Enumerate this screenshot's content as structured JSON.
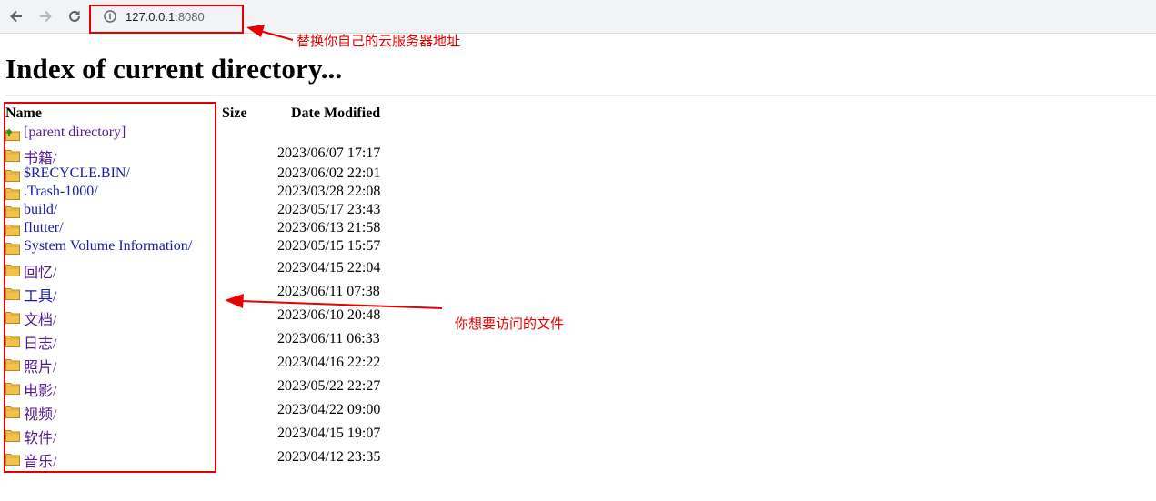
{
  "browser": {
    "url_host": "127.0.0.1",
    "url_port": ":8080"
  },
  "page": {
    "title": "Index of current directory...",
    "columns": {
      "name": "Name",
      "size": "Size",
      "date": "Date Modified"
    },
    "parent_link": "[parent directory]",
    "entries": [
      {
        "name": "书籍/",
        "date": "2023/06/07 17:17",
        "visited": true
      },
      {
        "name": "$RECYCLE.BIN/",
        "date": "2023/06/02 22:01",
        "visited": false
      },
      {
        "name": ".Trash-1000/",
        "date": "2023/03/28 22:08",
        "visited": false
      },
      {
        "name": "build/",
        "date": "2023/05/17 23:43",
        "visited": false
      },
      {
        "name": "flutter/",
        "date": "2023/06/13 21:58",
        "visited": false
      },
      {
        "name": "System Volume Information/",
        "date": "2023/05/15 15:57",
        "visited": false
      },
      {
        "name": "回忆/",
        "date": "2023/04/15 22:04",
        "visited": true
      },
      {
        "name": "工具/",
        "date": "2023/06/11 07:38",
        "visited": false
      },
      {
        "name": "文档/",
        "date": "2023/06/10 20:48",
        "visited": true
      },
      {
        "name": "日志/",
        "date": "2023/06/11 06:33",
        "visited": true
      },
      {
        "name": "照片/",
        "date": "2023/04/16 22:22",
        "visited": true
      },
      {
        "name": "电影/",
        "date": "2023/05/22 22:27",
        "visited": true
      },
      {
        "name": "视频/",
        "date": "2023/04/22 09:00",
        "visited": true
      },
      {
        "name": "软件/",
        "date": "2023/04/15 19:07",
        "visited": true
      },
      {
        "name": "音乐/",
        "date": "2023/04/12 23:35",
        "visited": true
      }
    ]
  },
  "annotations": {
    "address_note": "替换你自己的云服务器地址",
    "files_note": "你想要访问的文件",
    "color": "#e60000"
  },
  "icons": {
    "back": "arrow-left-icon",
    "forward": "arrow-right-icon",
    "reload": "reload-icon",
    "info": "info-icon",
    "folder": "folder-icon",
    "parent": "parent-directory-icon"
  }
}
